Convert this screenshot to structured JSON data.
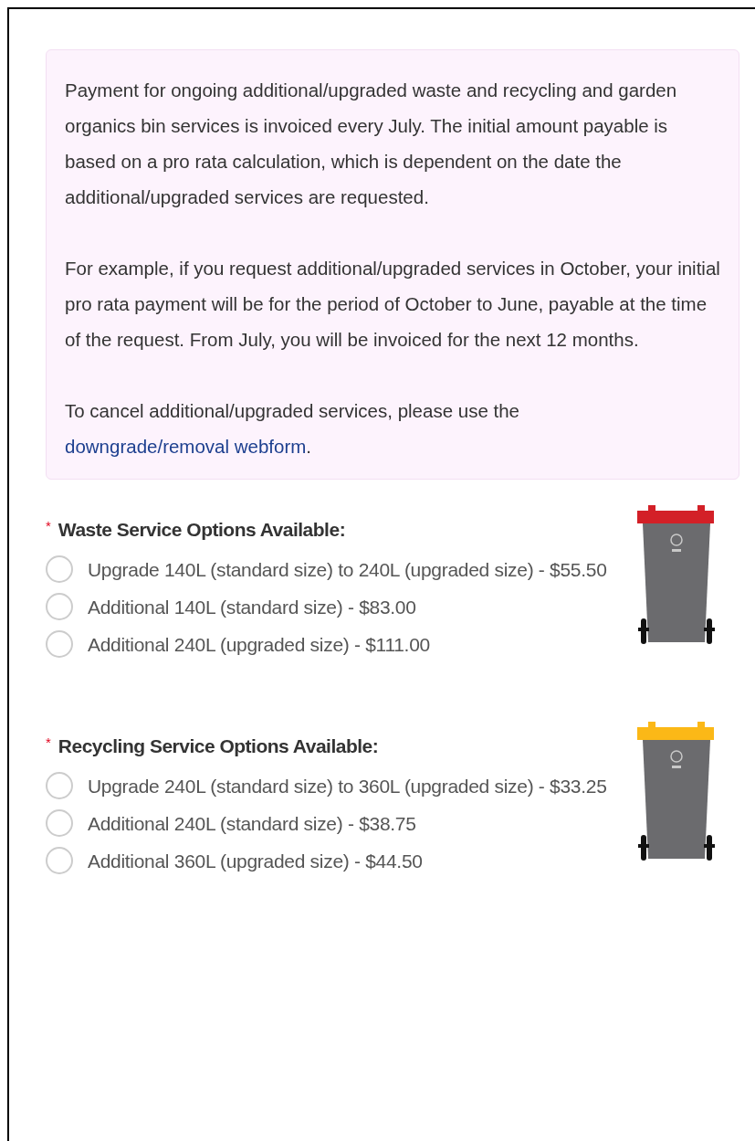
{
  "notice": {
    "paragraphs": [
      {
        "text": "Payment for ongoing additional/upgraded waste and recycling and garden organics bin services is invoiced every July. The initial amount payable is based on a pro rata calculation, which is dependent on the date the additional/upgraded services are requested."
      },
      {
        "text": "For example, if you request additional/upgraded services in October, your initial pro rata payment will be for the period of October to June, payable at the time of the request. From July, you will be invoiced for the next 12 months."
      },
      {
        "text": "To cancel additional/upgraded services, please use the",
        "link": "downgrade/removal webform",
        "after": "."
      }
    ]
  },
  "sections": [
    {
      "required_mark": "*",
      "title": "Waste Service Options Available:",
      "color": "#d32027",
      "options": [
        {
          "label": "Upgrade 140L (standard size) to 240L (upgraded size) - $55.50",
          "selected": false
        },
        {
          "label": "Additional 140L (standard size) - $83.00",
          "selected": false
        },
        {
          "label": "Additional 240L (upgraded size) - $111.00",
          "selected": false
        }
      ]
    },
    {
      "required_mark": "*",
      "title": "Recycling Service Options Available:",
      "color": "#fbb817",
      "options": [
        {
          "label": "Upgrade 240L (standard size) to 360L (upgraded size) - $33.25",
          "selected": false
        },
        {
          "label": "Additional 240L (standard size) - $38.75",
          "selected": false
        },
        {
          "label": "Additional 360L (upgraded size) - $44.50",
          "selected": false
        }
      ]
    }
  ]
}
